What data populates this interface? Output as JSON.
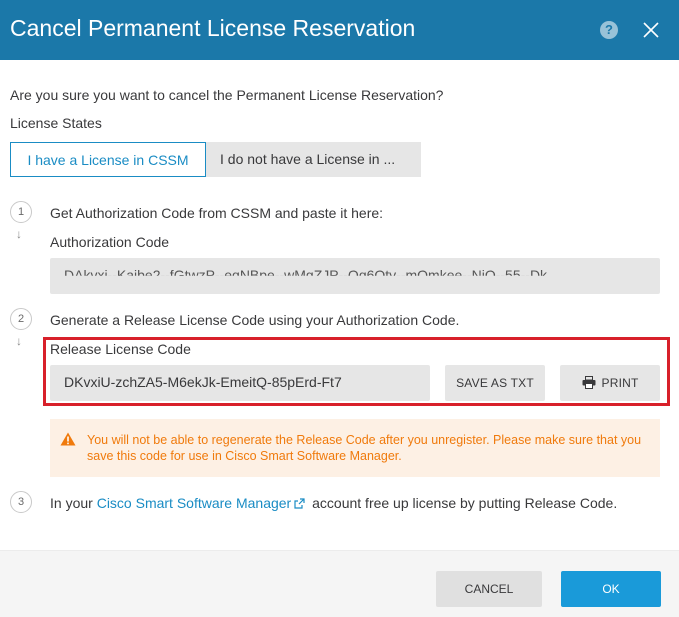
{
  "dialog": {
    "title": "Cancel Permanent License Reservation",
    "help_icon": "?"
  },
  "question": "Are you sure you want to cancel the Permanent License Reservation?",
  "license_states": {
    "label": "License States",
    "tabs": [
      {
        "label": "I have a License in CSSM",
        "active": true
      },
      {
        "label": "I do not have a License in ...",
        "active": false
      }
    ]
  },
  "step1": {
    "number": "1",
    "arrow": "↓",
    "text": "Get Authorization Code from CSSM and paste it here:",
    "field_label": "Authorization Code",
    "field_value": "DAkvxi--Kaibe2--fGtwzP--eqNBpe--wMgZJP--Oq6Qty--mQmkee--NiQ--55--Dk"
  },
  "step2": {
    "number": "2",
    "arrow": "↓",
    "text": "Generate a Release License Code using your Authorization Code.",
    "field_label": "Release License Code",
    "field_value": "DKvxiU-zchZA5-M6ekJk-EmeitQ-85pErd-Ft7",
    "save_button": "SAVE AS TXT",
    "print_button": "PRINT"
  },
  "warning": {
    "text": "You will not be able to regenerate the Release Code after you unregister. Please make sure that you save this code for use in Cisco Smart Software Manager."
  },
  "step3": {
    "number": "3",
    "prefix": "In your ",
    "link": "Cisco Smart Software Manager",
    "suffix": " account free up license by putting Release Code."
  },
  "footer": {
    "cancel": "CANCEL",
    "ok": "OK"
  },
  "colors": {
    "header": "#1b78a9",
    "accent": "#1a8cc4",
    "primary_button": "#1a9ad9",
    "highlight": "#d8202a",
    "warning_text": "#f07a0c",
    "warning_bg": "#fdf0e4"
  }
}
